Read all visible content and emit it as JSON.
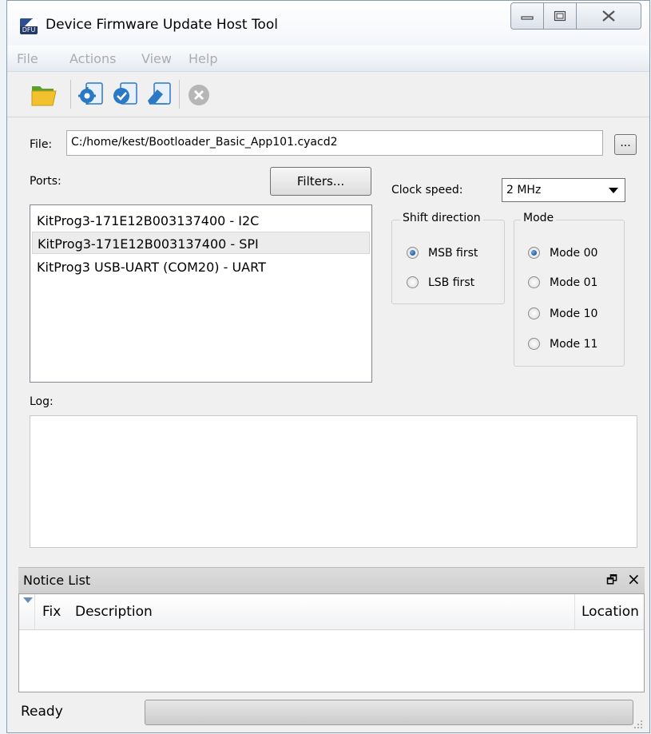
{
  "window": {
    "title": "Device Firmware Update Host Tool",
    "icon_text": "DFU"
  },
  "menu": [
    "File",
    "Actions",
    "View",
    "Help"
  ],
  "toolbar": {
    "open_icon": "folder-open-icon",
    "program_icon": "program-gear-icon",
    "verify_icon": "verify-check-icon",
    "erase_icon": "erase-icon",
    "abort_icon": "abort-x-icon"
  },
  "file": {
    "label": "File:",
    "value": "C:/home/kest/Bootloader_Basic_App101.cyacd2",
    "browse_label": "..."
  },
  "ports": {
    "label": "Ports:",
    "filters_label": "Filters...",
    "items": [
      "KitProg3-171E12B003137400 - I2C",
      "KitProg3-171E12B003137400 - SPI",
      "KitProg3 USB-UART (COM20) - UART"
    ],
    "selected_index": 1
  },
  "clock": {
    "label": "Clock speed:",
    "value": "2 MHz"
  },
  "shift_direction": {
    "title": "Shift direction",
    "options": [
      "MSB first",
      "LSB first"
    ],
    "selected_index": 0
  },
  "mode": {
    "title": "Mode",
    "options": [
      "Mode 00",
      "Mode 01",
      "Mode 10",
      "Mode 11"
    ],
    "selected_index": 0
  },
  "log": {
    "label": "Log:"
  },
  "notice_list": {
    "title": "Notice List",
    "float_glyph": "🗗",
    "close_glyph": "×",
    "columns": [
      "Fix",
      "Description",
      "Location"
    ]
  },
  "status": {
    "text": "Ready",
    "progress": 0
  },
  "colors": {
    "accent": "#1a6fc4",
    "radio_dot": "#0d3f86",
    "window_bg": "#f0f0f0"
  }
}
